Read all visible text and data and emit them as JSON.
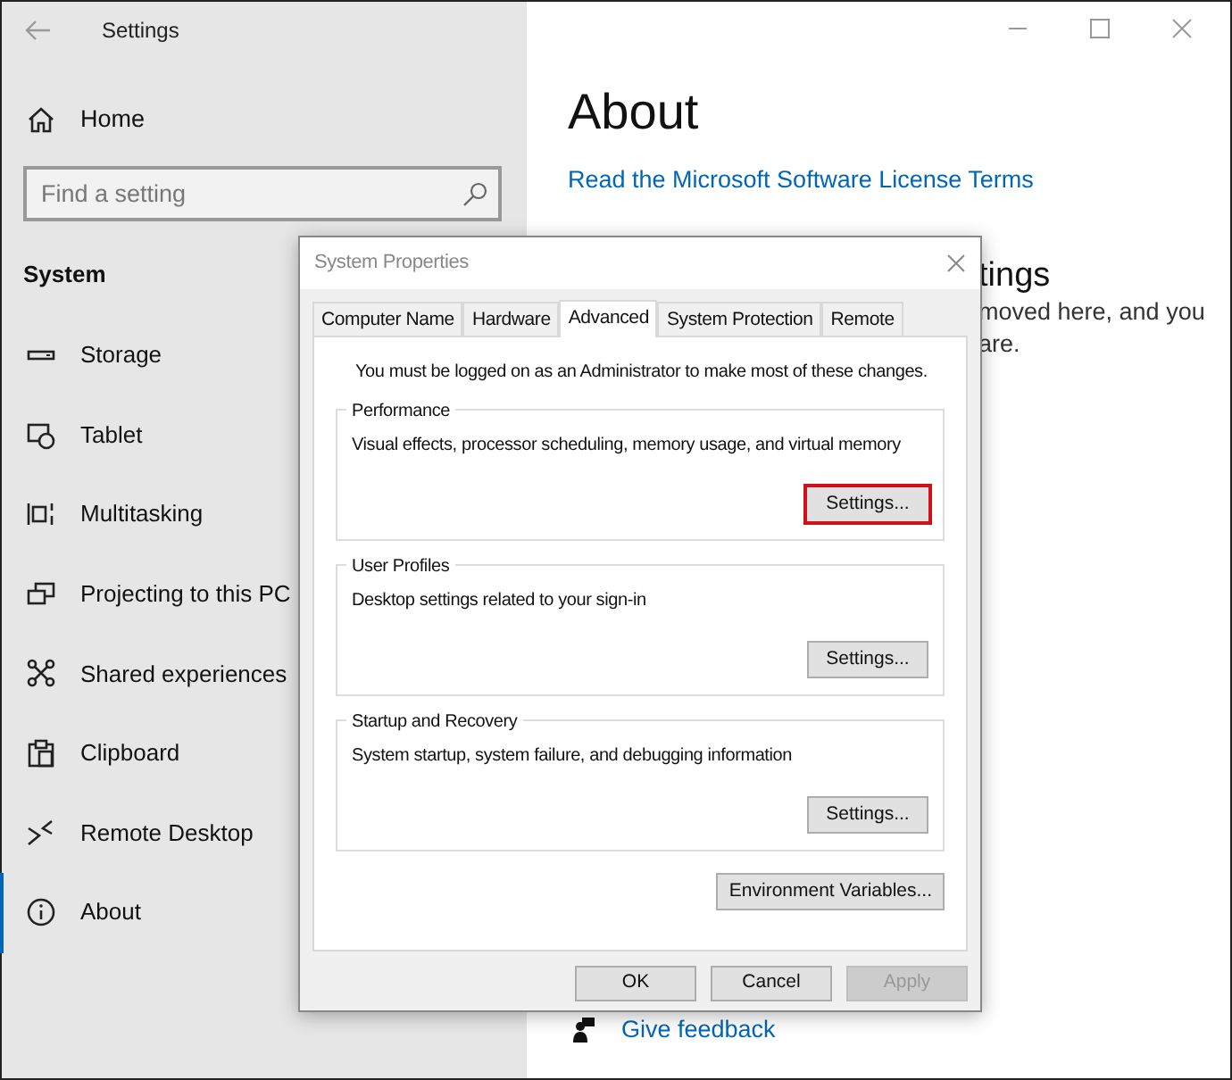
{
  "window": {
    "title": "Settings"
  },
  "sidebar": {
    "home": "Home",
    "search": {
      "placeholder": "Find a setting"
    },
    "section": "System",
    "items": [
      {
        "label": "Storage",
        "selected": false
      },
      {
        "label": "Tablet",
        "selected": false
      },
      {
        "label": "Multitasking",
        "selected": false
      },
      {
        "label": "Projecting to this PC",
        "selected": false
      },
      {
        "label": "Shared experiences",
        "selected": false
      },
      {
        "label": "Clipboard",
        "selected": false
      },
      {
        "label": "Remote Desktop",
        "selected": false
      },
      {
        "label": "About",
        "selected": true
      }
    ]
  },
  "main": {
    "heading": "About",
    "license_link": "Read the Microsoft Software License Terms",
    "partial_heading": "tings",
    "partial_lines": [
      "moved here, and you",
      "are."
    ],
    "feedback_link": "Give feedback"
  },
  "dialog": {
    "title": "System Properties",
    "tabs": [
      {
        "label": "Computer Name",
        "selected": false
      },
      {
        "label": "Hardware",
        "selected": false
      },
      {
        "label": "Advanced",
        "selected": true
      },
      {
        "label": "System Protection",
        "selected": false
      },
      {
        "label": "Remote",
        "selected": false
      }
    ],
    "notice": "You must be logged on as an Administrator to make most of these changes.",
    "groups": [
      {
        "title": "Performance",
        "description": "Visual effects, processor scheduling, memory usage, and virtual memory",
        "button": "Settings...",
        "highlighted": true
      },
      {
        "title": "User Profiles",
        "description": "Desktop settings related to your sign-in",
        "button": "Settings...",
        "highlighted": false
      },
      {
        "title": "Startup and Recovery",
        "description": "System startup, system failure, and debugging information",
        "button": "Settings...",
        "highlighted": false
      }
    ],
    "env_button": "Environment Variables...",
    "footer_buttons": [
      {
        "label": "OK",
        "disabled": false
      },
      {
        "label": "Cancel",
        "disabled": false
      },
      {
        "label": "Apply",
        "disabled": true
      }
    ]
  }
}
